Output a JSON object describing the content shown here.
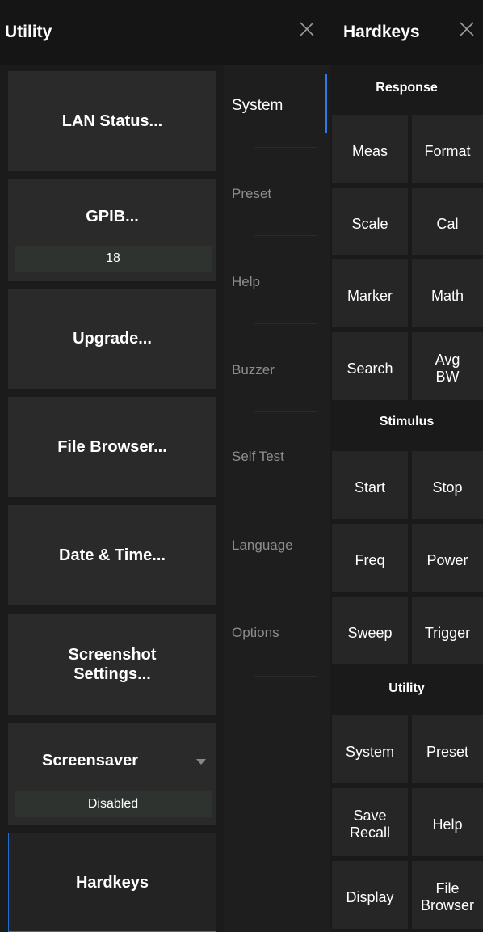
{
  "utility": {
    "title": "Utility",
    "buttons": {
      "lan_status": "LAN Status...",
      "gpib": "GPIB...",
      "gpib_value": "18",
      "upgrade": "Upgrade...",
      "file_browser": "File Browser...",
      "date_time": "Date & Time...",
      "screenshot_settings": "Screenshot\nSettings...",
      "screensaver": "Screensaver",
      "screensaver_value": "Disabled",
      "hardkeys": "Hardkeys"
    }
  },
  "tabs": {
    "system": "System",
    "preset": "Preset",
    "help": "Help",
    "buzzer": "Buzzer",
    "self_test": "Self Test",
    "language": "Language",
    "options": "Options",
    "active": "System"
  },
  "hardkeys": {
    "title": "Hardkeys",
    "sections": {
      "response": "Response",
      "stimulus": "Stimulus",
      "utility": "Utility"
    },
    "keys": {
      "meas": "Meas",
      "format": "Format",
      "scale": "Scale",
      "cal": "Cal",
      "marker": "Marker",
      "math": "Math",
      "search": "Search",
      "avg_bw": "Avg\nBW",
      "start": "Start",
      "stop": "Stop",
      "freq": "Freq",
      "power": "Power",
      "sweep": "Sweep",
      "trigger": "Trigger",
      "system": "System",
      "preset": "Preset",
      "save_recall": "Save\nRecall",
      "help": "Help",
      "display": "Display",
      "file_browser": "File\nBrowser"
    }
  },
  "icons": {
    "close": "close-icon",
    "dropdown": "chevron-down-icon"
  },
  "colors": {
    "accent": "#2e7ce0",
    "background": "#1c1c1c",
    "button": "#2a2a2a",
    "value_field": "#2f3330"
  }
}
